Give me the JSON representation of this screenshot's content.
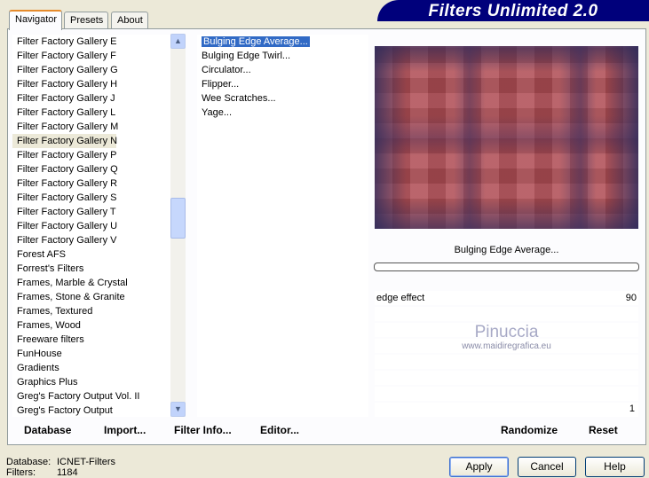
{
  "tabs": [
    "Navigator",
    "Presets",
    "About"
  ],
  "banner": "Filters Unlimited 2.0",
  "categories": [
    "Filter Factory Gallery E",
    "Filter Factory Gallery F",
    "Filter Factory Gallery G",
    "Filter Factory Gallery H",
    "Filter Factory Gallery J",
    "Filter Factory Gallery L",
    "Filter Factory Gallery M",
    "Filter Factory Gallery N",
    "Filter Factory Gallery P",
    "Filter Factory Gallery Q",
    "Filter Factory Gallery R",
    "Filter Factory Gallery S",
    "Filter Factory Gallery T",
    "Filter Factory Gallery U",
    "Filter Factory Gallery V",
    "Forest AFS",
    "Forrest's Filters",
    "Frames, Marble & Crystal",
    "Frames, Stone & Granite",
    "Frames, Textured",
    "Frames, Wood",
    "Freeware filters",
    "FunHouse",
    "Gradients",
    "Graphics Plus",
    "Greg's Factory Output Vol. II",
    "Greg's Factory Output"
  ],
  "selected_category": "Filter Factory Gallery N",
  "filters": [
    "Bulging Edge Average...",
    "Bulging Edge Twirl...",
    "Circulator...",
    "Flipper...",
    "Wee Scratches...",
    "Yage..."
  ],
  "selected_filter": "Bulging Edge Average...",
  "filter_name": "Bulging Edge Average...",
  "params": {
    "p1_label": "edge effect",
    "p1_value": "90",
    "p8_value": "1"
  },
  "watermark": {
    "name": "Pinuccia",
    "url": "www.maidiregrafica.eu"
  },
  "bottom_buttons": {
    "database": "Database",
    "import": "Import...",
    "filter_info": "Filter Info...",
    "editor": "Editor...",
    "randomize": "Randomize",
    "reset": "Reset"
  },
  "status": {
    "db_label": "Database:",
    "db_value": "ICNET-Filters",
    "filters_label": "Filters:",
    "filters_value": "1184"
  },
  "dialog_buttons": {
    "apply": "Apply",
    "cancel": "Cancel",
    "help": "Help"
  }
}
